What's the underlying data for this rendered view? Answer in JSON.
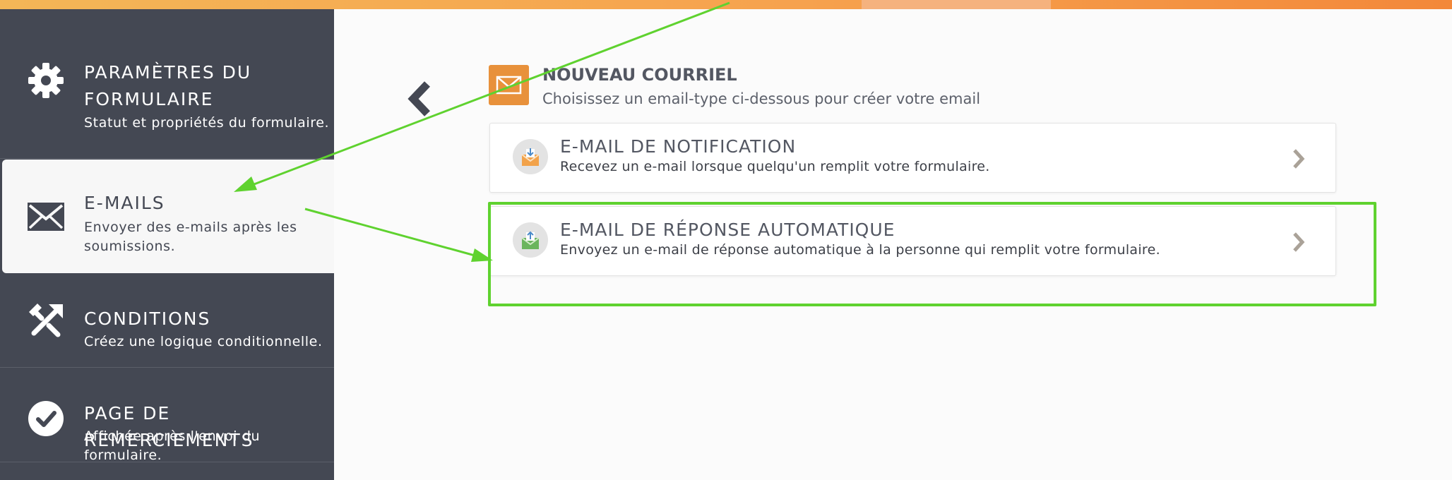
{
  "sidebar": {
    "items": [
      {
        "title_line1": "PARAMÈTRES DU",
        "title_line2": "FORMULAIRE",
        "desc": "Statut et propriétés du formulaire.",
        "icon": "gear-icon"
      },
      {
        "title": "E-MAILS",
        "desc_line1": "Envoyer des e-mails après les",
        "desc_line2": "soumissions.",
        "icon": "envelope-icon",
        "active": true
      },
      {
        "title": "CONDITIONS",
        "desc": "Créez une logique conditionnelle.",
        "icon": "conditions-icon"
      },
      {
        "title": "PAGE DE REMERCIEMENTS",
        "desc": "Affichée après l'envoi du formulaire.",
        "icon": "check-circle-icon"
      }
    ]
  },
  "main": {
    "header": {
      "title": "NOUVEAU COURRIEL",
      "subtitle": "Choisissez un email-type ci-dessous pour créer votre email",
      "icon": "envelope-icon"
    },
    "cards": [
      {
        "title": "E-MAIL DE NOTIFICATION",
        "desc": "Recevez un e-mail lorsque quelqu'un remplit votre formulaire.",
        "icon": "notification-envelope-icon"
      },
      {
        "title": "E-MAIL DE RÉPONSE AUTOMATIQUE",
        "desc": "Envoyez un e-mail de réponse automatique à la personne qui remplit votre formulaire.",
        "icon": "autoresponder-envelope-icon"
      }
    ]
  },
  "colors": {
    "accent": "#e8913b",
    "sidebar": "#444853",
    "annotation": "#5fd22f"
  }
}
